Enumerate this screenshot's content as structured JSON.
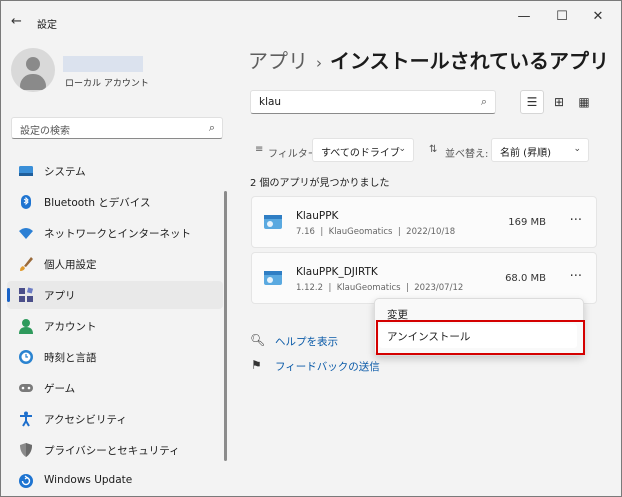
{
  "window": {
    "title": "設定",
    "back_glyph": "←",
    "min_glyph": "—",
    "max_glyph": "☐",
    "close_glyph": "✕"
  },
  "account": {
    "type": "ローカル アカウント"
  },
  "sidebar": {
    "search_placeholder": "設定の検索",
    "search_glyph": "⌕",
    "items": [
      {
        "label": "システム",
        "icon": "monitor-icon"
      },
      {
        "label": "Bluetooth とデバイス",
        "icon": "bluetooth-icon"
      },
      {
        "label": "ネットワークとインターネット",
        "icon": "wifi-icon"
      },
      {
        "label": "個人用設定",
        "icon": "brush-icon"
      },
      {
        "label": "アプリ",
        "icon": "apps-icon",
        "active": true
      },
      {
        "label": "アカウント",
        "icon": "person-icon"
      },
      {
        "label": "時刻と言語",
        "icon": "globe-clock-icon"
      },
      {
        "label": "ゲーム",
        "icon": "gamepad-icon"
      },
      {
        "label": "アクセシビリティ",
        "icon": "accessibility-icon"
      },
      {
        "label": "プライバシーとセキュリティ",
        "icon": "shield-icon"
      },
      {
        "label": "Windows Update",
        "icon": "update-icon"
      }
    ]
  },
  "breadcrumb": {
    "parent": "アプリ",
    "separator": "›",
    "current": "インストールされているアプリ"
  },
  "search": {
    "value": "klau",
    "glyph": "⌕"
  },
  "view_buttons": {
    "list": "☰",
    "grid": "⊞",
    "tile": "▦"
  },
  "filter": {
    "icon_glyph": "≡",
    "label": "フィルター:",
    "value": "すべてのドライブ",
    "chevron": "⌄"
  },
  "sort": {
    "icon_glyph": "⇅",
    "label": "並べ替え:",
    "value": "名前 (昇順)",
    "chevron": "⌄"
  },
  "result_count": "2 個のアプリが見つかりました",
  "apps": [
    {
      "name": "KlauPPK",
      "version": "7.16",
      "publisher": "KlauGeomatics",
      "date": "2022/10/18",
      "size": "169 MB",
      "more": "···"
    },
    {
      "name": "KlauPPK_DJIRTK",
      "version": "1.12.2",
      "publisher": "KlauGeomatics",
      "date": "2023/07/12",
      "size": "68.0 MB",
      "more": "···"
    }
  ],
  "meta_sep": "|",
  "context_menu": {
    "modify": "変更",
    "uninstall": "アンインストール"
  },
  "links": {
    "help": "ヘルプを表示",
    "help_glyph": "🔍︎",
    "feedback": "フィードバックの送信",
    "feedback_glyph": "⚑"
  },
  "colors": {
    "accent": "#1a63c7",
    "highlight_box": "#d40000",
    "link": "#0a5aa8"
  }
}
